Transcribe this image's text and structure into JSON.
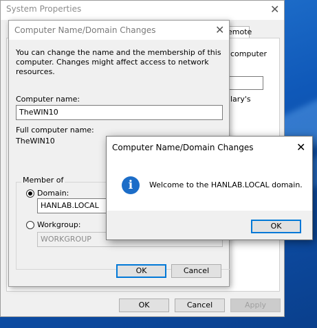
{
  "system_properties": {
    "title": "System Properties",
    "remote_tab": "emote",
    "fragment_line1": "computer",
    "fragment_line2": "lary's",
    "ok_label": "OK",
    "cancel_label": "Cancel",
    "apply_label": "Apply"
  },
  "name_dialog": {
    "title": "Computer Name/Domain Changes",
    "description": "You can change the name and the membership of this computer. Changes might affect access to network resources.",
    "computer_name_label": "Computer name:",
    "computer_name_value": "TheWIN10",
    "full_name_label": "Full computer name:",
    "full_name_value": "TheWIN10",
    "member_of_label": "Member of",
    "domain_label": "Domain:",
    "domain_value": "HANLAB.LOCAL",
    "domain_selected": true,
    "workgroup_label": "Workgroup:",
    "workgroup_value": "WORKGROUP",
    "ok_label": "OK",
    "cancel_label": "Cancel"
  },
  "welcome_dialog": {
    "title": "Computer Name/Domain Changes",
    "icon": "info-icon",
    "message": "Welcome to the HANLAB.LOCAL domain.",
    "ok_label": "OK"
  },
  "colors": {
    "accent": "#0078d7",
    "info_icon": "#1c6dc8",
    "desktop": "#1560c0"
  }
}
